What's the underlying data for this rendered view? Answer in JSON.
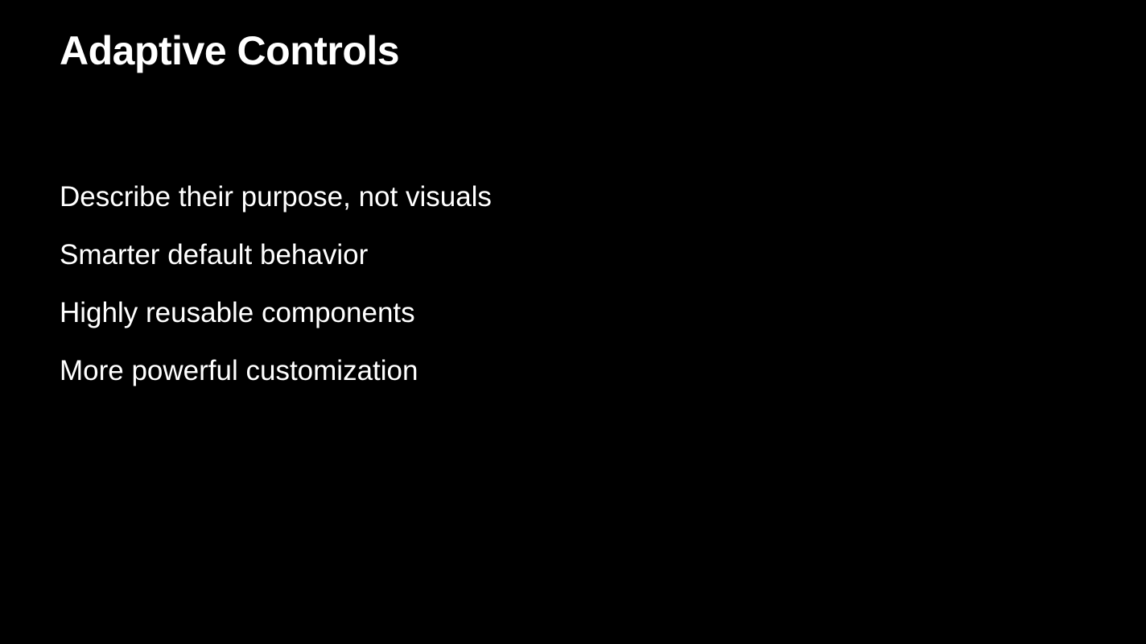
{
  "slide": {
    "title": "Adaptive Controls",
    "bullets": [
      "Describe their purpose, not visuals",
      "Smarter default behavior",
      "Highly reusable components",
      "More powerful customization"
    ]
  },
  "colors": {
    "background": "#000000",
    "text": "#ffffff"
  }
}
